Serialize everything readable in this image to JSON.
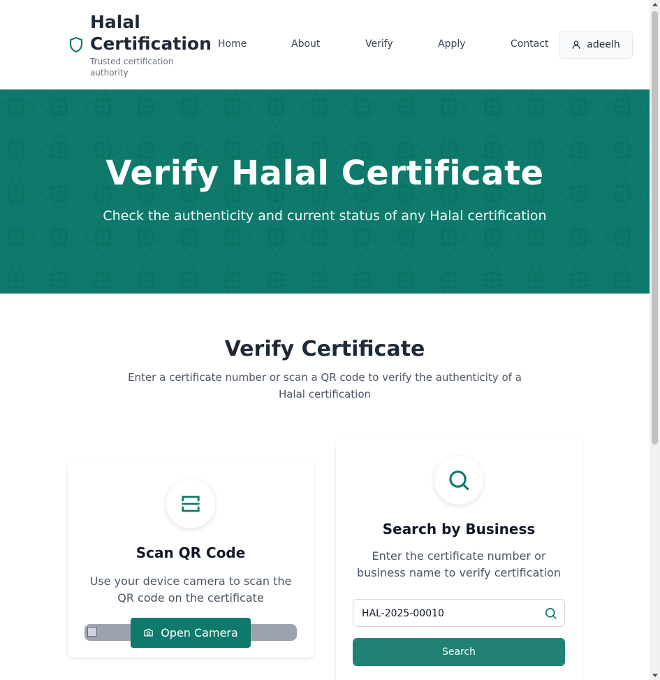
{
  "header": {
    "brand_title": "Halal Certification",
    "brand_subtitle": "Trusted certification authority",
    "brand_icon": "shield-icon",
    "nav": [
      {
        "label": "Home"
      },
      {
        "label": "About"
      },
      {
        "label": "Verify"
      },
      {
        "label": "Apply"
      },
      {
        "label": "Contact"
      }
    ],
    "user": {
      "name": "adeelh",
      "icon": "user-icon"
    }
  },
  "hero": {
    "title": "Verify Halal Certificate",
    "subtitle": "Check the authenticity and current status of any Halal certification"
  },
  "section": {
    "title": "Verify Certificate",
    "description": "Enter a certificate number or scan a QR code to verify the authenticity of a Halal certification"
  },
  "qr_card": {
    "icon": "qr-scan-icon",
    "title": "Scan QR Code",
    "description": "Use your device camera to scan the QR code on the certificate",
    "button_label": "Open Camera",
    "button_icon": "camera-icon"
  },
  "search_card": {
    "icon": "search-icon",
    "title": "Search by Business",
    "description": "Enter the certificate number or business name to verify certification",
    "input_value": "HAL-2025-00010",
    "button_label": "Search"
  },
  "colors": {
    "primary": "#0d7a6b",
    "button": "#1f8274"
  }
}
